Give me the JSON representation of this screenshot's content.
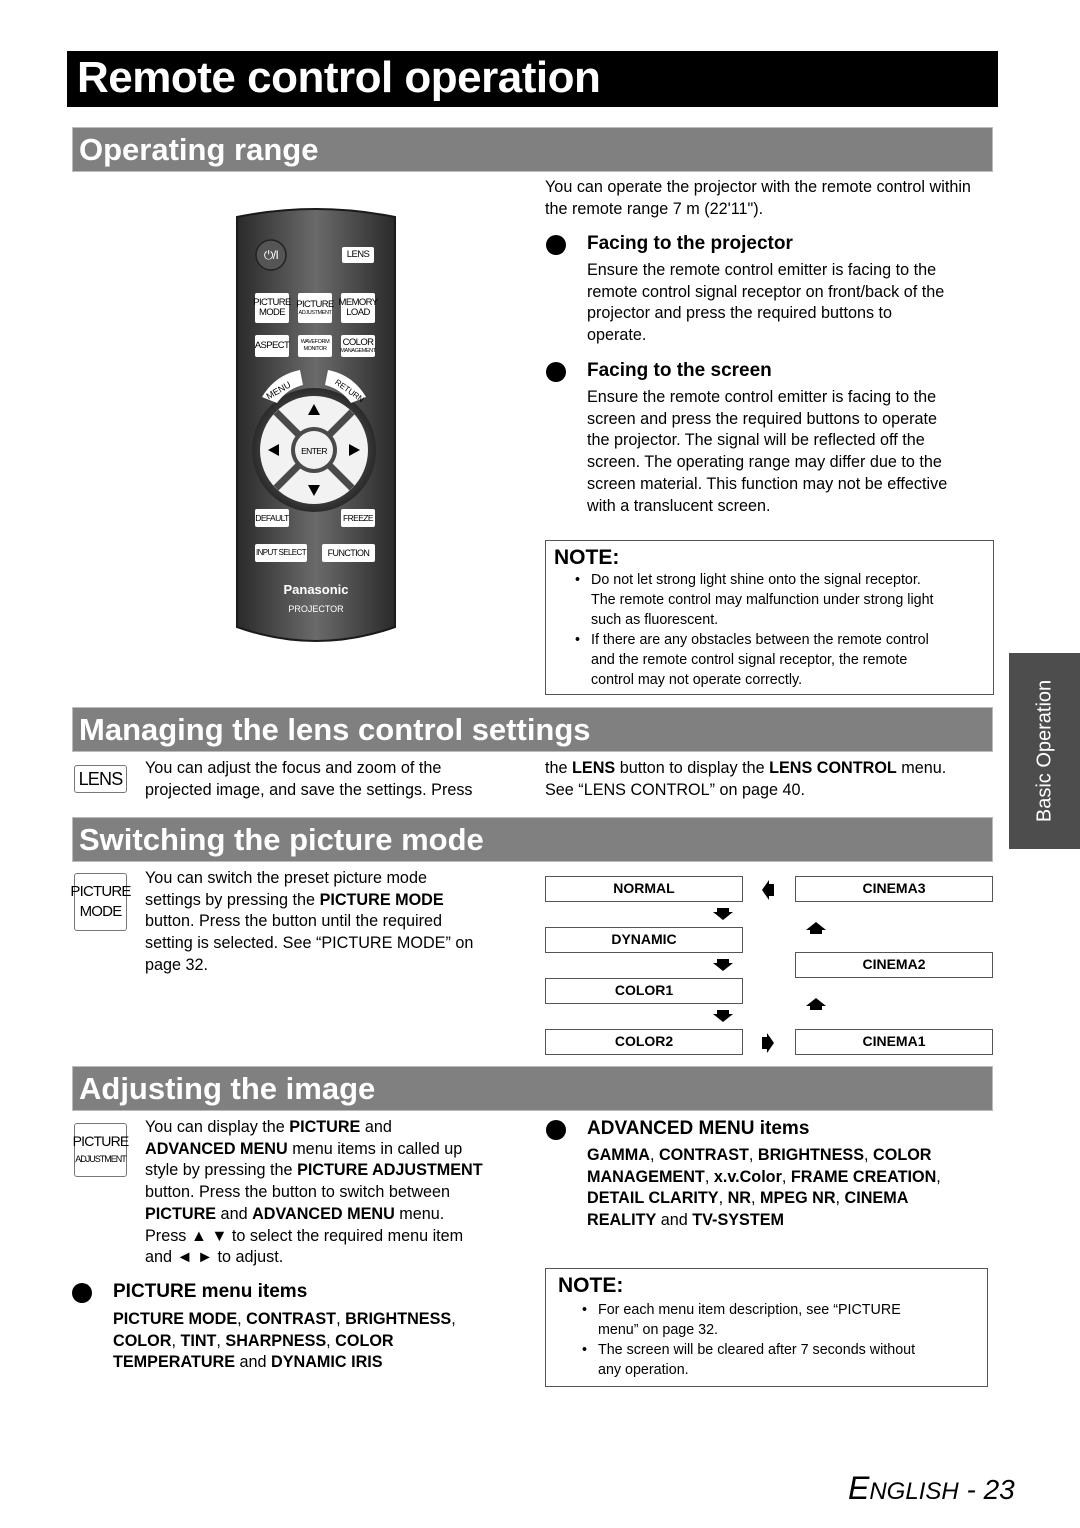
{
  "page_title": "Remote control operation",
  "sections": {
    "operating_range": {
      "title": "Operating range",
      "intro": "You can operate the projector with the remote control within the remote range 7 m (22'11\").",
      "bullets": [
        {
          "heading": "Facing to the projector",
          "lines": [
            "Ensure the remote control emitter is facing to the",
            "remote control signal receptor on front/back of the",
            "projector and press the required buttons to",
            "operate."
          ]
        },
        {
          "heading": "Facing to the screen",
          "lines": [
            "Ensure the remote control emitter is facing to the",
            "screen and press the required buttons to operate",
            "the projector. The signal will be reflected off the",
            "screen. The operating range may differ due to the",
            "screen material. This function may not be effective",
            "with a translucent screen."
          ]
        }
      ],
      "note": {
        "title": "NOTE:",
        "items": [
          {
            "lines": [
              "Do not let strong light shine onto the signal receptor.",
              "The remote control may malfunction under strong light",
              "such as fluorescent."
            ]
          },
          {
            "lines": [
              "If there are any obstacles between the remote control",
              "and the remote control signal receptor, the remote",
              "control may not operate correctly."
            ]
          }
        ]
      }
    },
    "lens": {
      "title": "Managing the lens control settings",
      "icon_label": "LENS",
      "left_lines": [
        "You can adjust the focus and zoom of the",
        "projected image, and save the settings. Press"
      ],
      "right": {
        "p1": "the ",
        "b1": "LENS",
        "p2": " button to display the ",
        "b2": "LENS CONTROL",
        "p3": " menu.",
        "line2": "See “LENS CONTROL” on page 40."
      }
    },
    "picture_mode": {
      "title": "Switching the picture mode",
      "icon_line1": "PICTURE",
      "icon_line2": "MODE",
      "line1": "You can switch the preset picture mode",
      "line2_pre": "settings by pressing the ",
      "line2_bold": "PICTURE MODE",
      "line3": "button. Press the button until the required",
      "line4": "setting is selected. See “PICTURE MODE” on",
      "line5": "page 32.",
      "modes_left": [
        "NORMAL",
        "DYNAMIC",
        "COLOR1",
        "COLOR2"
      ],
      "modes_right": [
        "CINEMA3",
        "CINEMA2",
        "CINEMA1"
      ]
    },
    "adjusting": {
      "title": "Adjusting the image",
      "icon_line1": "PICTURE",
      "icon_line2": "ADJUSTMENT",
      "l1_pre": "You can display the ",
      "l1_b": "PICTURE",
      "l1_post": " and",
      "l2_b": "ADVANCED MENU",
      "l2_post": " menu items in called up",
      "l3_pre": "style by pressing the ",
      "l3_b": "PICTURE ADJUSTMENT",
      "l4": "button. Press the button to switch between",
      "l5_b1": "PICTURE",
      "l5_mid": " and ",
      "l5_b2": "ADVANCED MENU",
      "l5_post": " menu.",
      "l6": "Press ▲ ▼ to select the required menu item",
      "l7": "and ◄ ► to adjust.",
      "picture_menu": {
        "heading": "PICTURE menu items",
        "l1": [
          "PICTURE MODE",
          ", ",
          "CONTRAST",
          ", ",
          "BRIGHTNESS",
          ","
        ],
        "l2": [
          "COLOR",
          ", ",
          "TINT",
          ", ",
          "SHARPNESS",
          ", ",
          "COLOR"
        ],
        "l3": [
          "TEMPERATURE",
          " and ",
          "DYNAMIC IRIS"
        ]
      },
      "advanced_menu": {
        "heading": "ADVANCED MENU items",
        "l1": [
          "GAMMA",
          ", ",
          "CONTRAST",
          ", ",
          "BRIGHTNESS",
          ", ",
          "COLOR"
        ],
        "l2": [
          "MANAGEMENT",
          ", ",
          "x.v.Color",
          ", ",
          "FRAME CREATION",
          ","
        ],
        "l3": [
          "DETAIL CLARITY",
          ", ",
          "NR",
          ", ",
          "MPEG NR",
          ", ",
          "CINEMA"
        ],
        "l4": [
          "REALITY",
          " and ",
          "TV-SYSTEM"
        ]
      },
      "note": {
        "title": "NOTE:",
        "items": [
          {
            "lines": [
              "For each menu item description, see “PICTURE",
              "menu” on page 32."
            ]
          },
          {
            "lines": [
              "The screen will be cleared after 7 seconds without",
              "any operation."
            ]
          }
        ]
      }
    }
  },
  "remote": {
    "power": "⏻/I",
    "lens": "LENS",
    "picture_mode": [
      "PICTURE",
      "MODE"
    ],
    "picture_adjustment": [
      "PICTURE",
      "ADJUSTMENT"
    ],
    "memory_load": [
      "MEMORY",
      "LOAD"
    ],
    "aspect": "ASPECT",
    "waveform_monitor": [
      "WAVEFORM",
      "MONITOR"
    ],
    "color_management": [
      "COLOR",
      "MANAGEMENT"
    ],
    "menu": "MENU",
    "return": "RETURN",
    "enter": "ENTER",
    "default": "DEFAULT",
    "freeze": "FREEZE",
    "input_select": "INPUT SELECT",
    "function": "FUNCTION",
    "brand": "Panasonic",
    "model_label": "PROJECTOR"
  },
  "side_tab": "Basic Operation",
  "footer": {
    "language": "ENGLISH",
    "separator": " - ",
    "page": "23"
  }
}
